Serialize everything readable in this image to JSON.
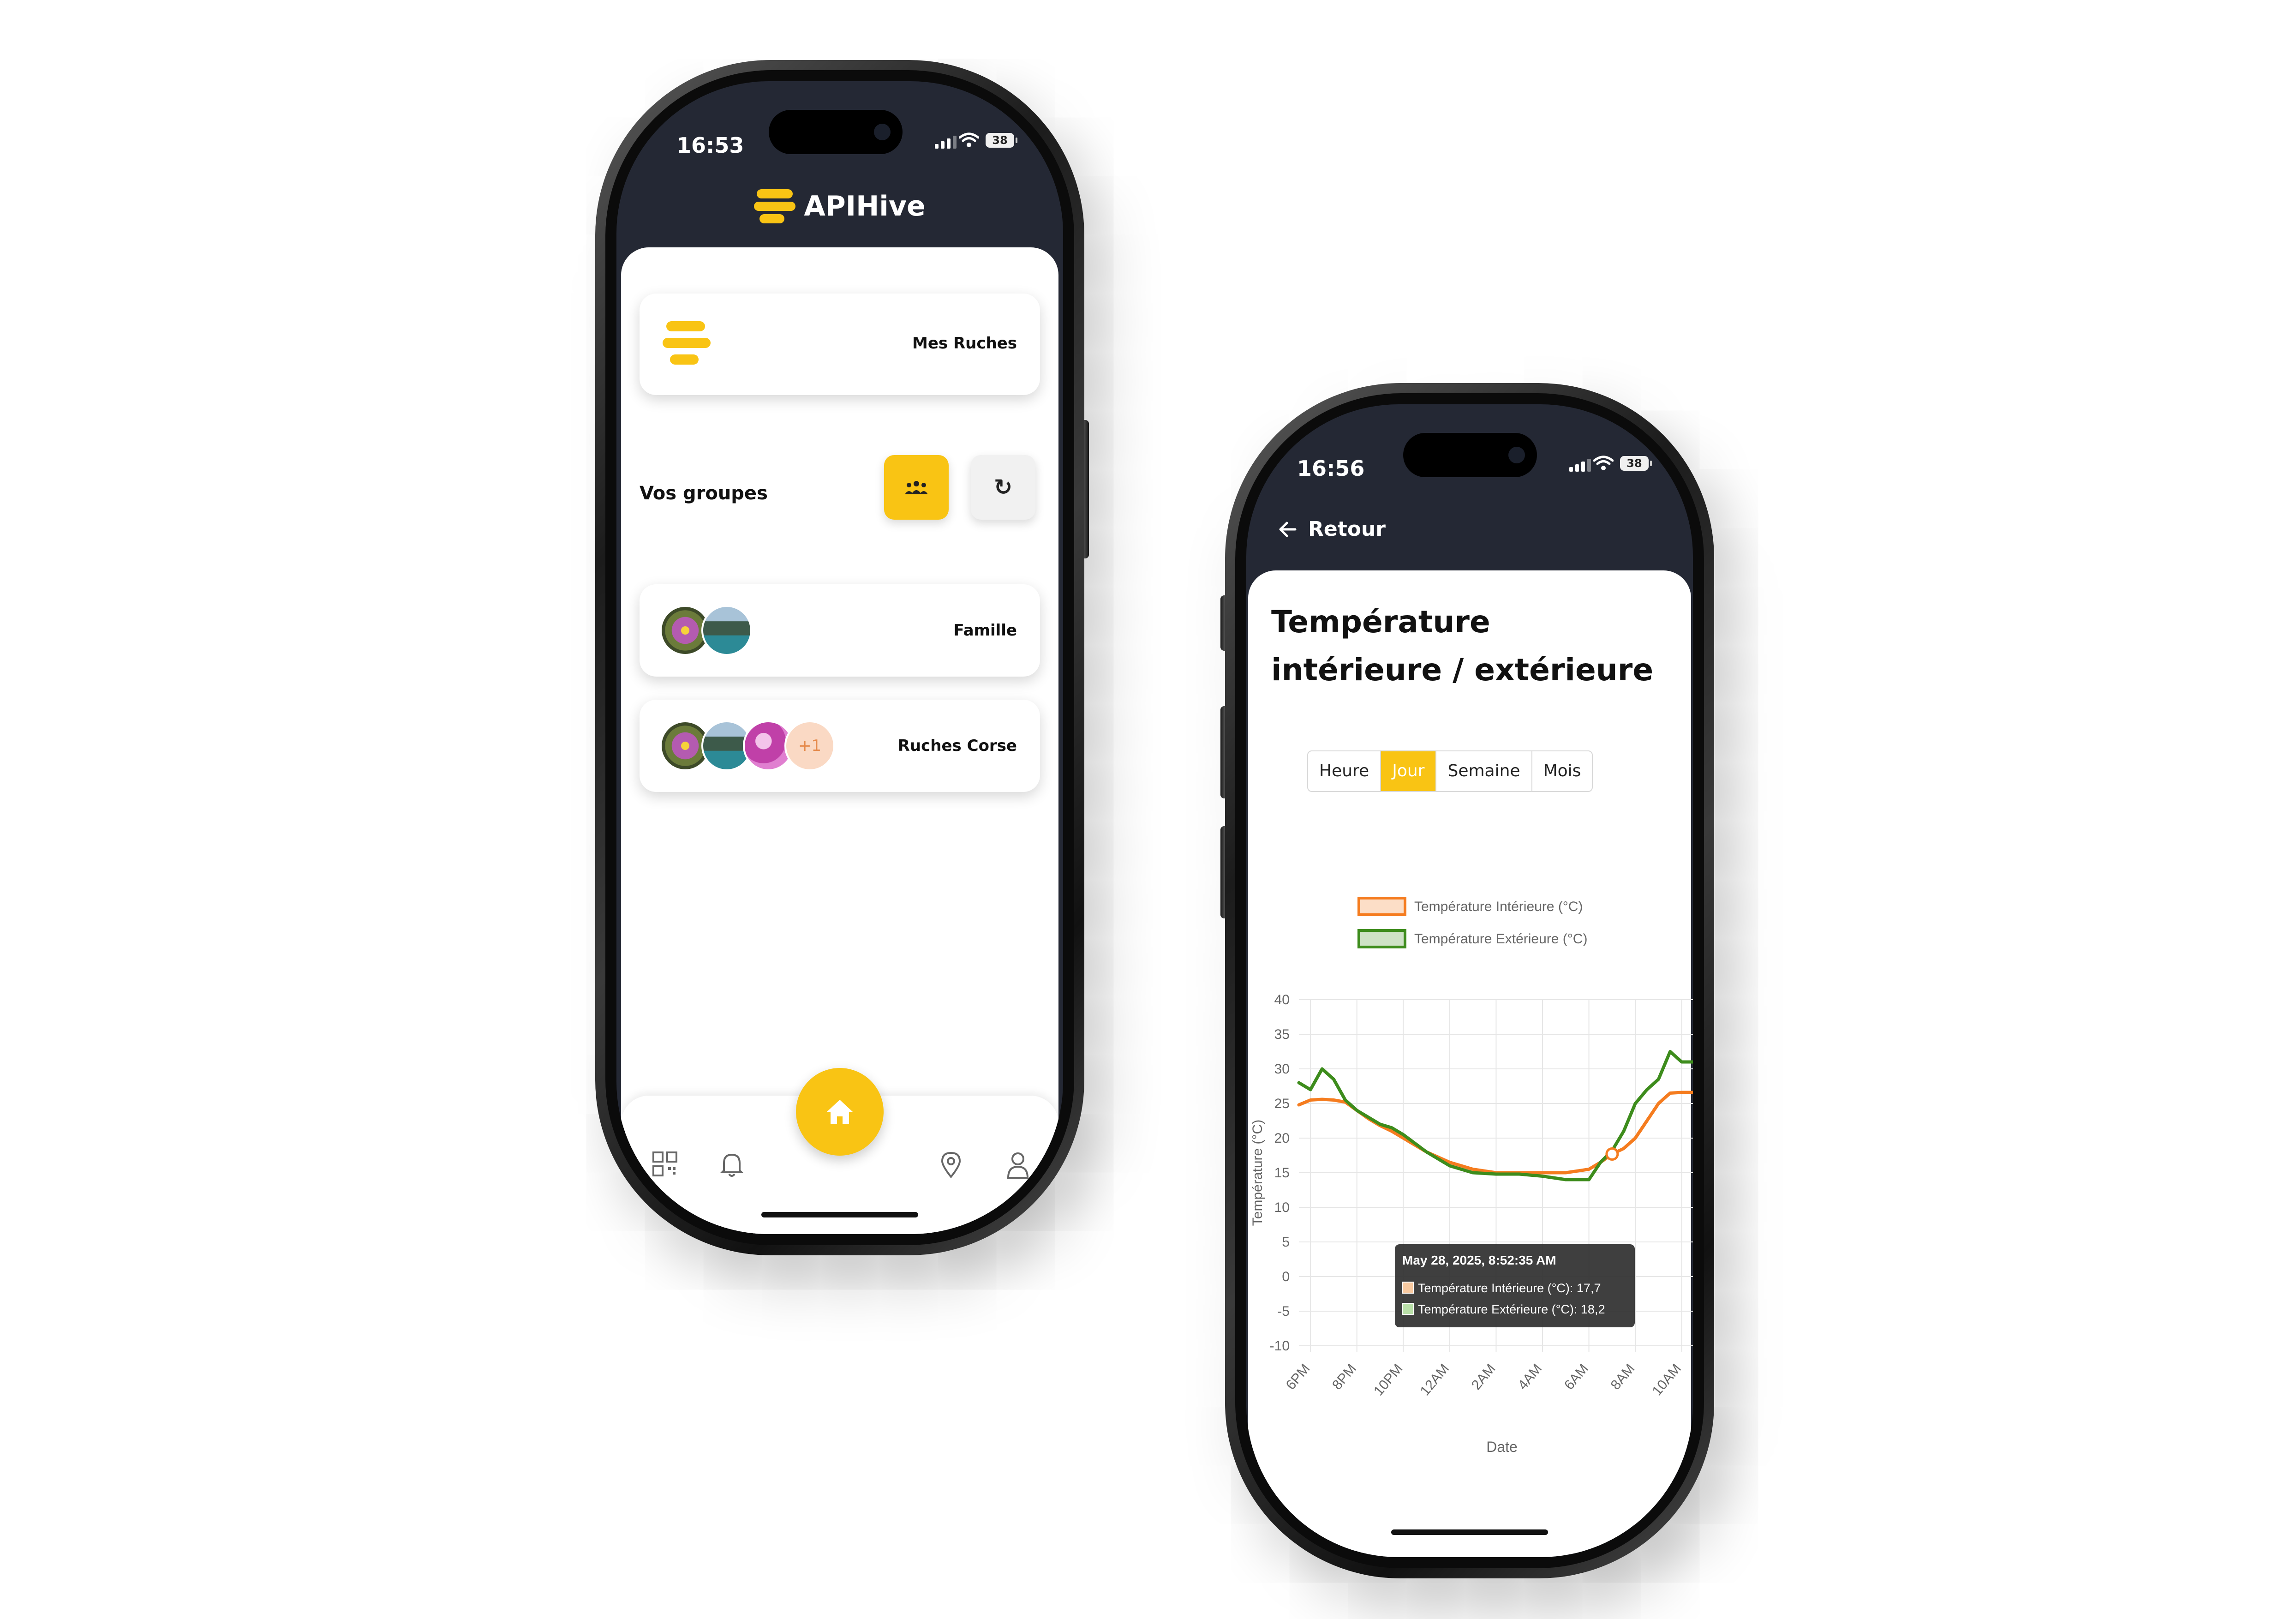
{
  "phone1": {
    "status": {
      "time": "16:53",
      "battery": "38"
    },
    "app_name": "APIHive",
    "hives_card": {
      "label": "Mes Ruches",
      "icon": "hive-logo-icon"
    },
    "groups": {
      "title": "Vos groupes",
      "groups_button_icon": "group-people-icon",
      "refresh_button_icon": "refresh-icon",
      "refresh_glyph": "↻",
      "items": [
        {
          "name": "Famille",
          "avatars": [
            "flower",
            "lake"
          ],
          "extra": ""
        },
        {
          "name": "Ruches Corse",
          "avatars": [
            "flower",
            "lake",
            "pink"
          ],
          "extra": "+1"
        }
      ]
    },
    "nav": {
      "items": [
        "qr-code-icon",
        "bell-icon",
        "home-icon",
        "map-pin-icon",
        "user-icon"
      ]
    }
  },
  "phone2": {
    "status": {
      "time": "16:56",
      "battery": "38"
    },
    "back_label": "Retour",
    "title": "Température intérieure / extérieure",
    "tabs": [
      "Heure",
      "Jour",
      "Semaine",
      "Mois"
    ],
    "active_tab": "Jour",
    "colors": {
      "accent": "#f9c414",
      "interior": "#f57c1f",
      "exterior": "#3d8c1c",
      "dark": "#242834"
    },
    "tooltip": {
      "title": "May 28, 2025, 8:52:35 AM",
      "interior": "Température Intérieure (°C): 17,7",
      "exterior": "Température Extérieure (°C): 18,2"
    }
  },
  "chart_data": {
    "type": "line",
    "xlabel": "Date",
    "ylabel": "Température (°C)",
    "ylim": [
      -10,
      40
    ],
    "yticks": [
      40,
      35,
      30,
      25,
      20,
      15,
      10,
      5,
      0,
      -5,
      -10
    ],
    "x_tick_labels": [
      "6PM",
      "8PM",
      "10PM",
      "12AM",
      "2AM",
      "4AM",
      "6AM",
      "8AM",
      "10AM"
    ],
    "x_hours": [
      17.5,
      18,
      18.5,
      19,
      19.5,
      20,
      20.5,
      21,
      21.5,
      22,
      23,
      24,
      25,
      26,
      27,
      28,
      29,
      30,
      30.5,
      31,
      31.5,
      32,
      32.5,
      33,
      33.5,
      34,
      34.5,
      35
    ],
    "series": [
      {
        "name": "Température Intérieure (°C)",
        "color": "#f57c1f",
        "values": [
          24.8,
          25.5,
          25.6,
          25.5,
          25.2,
          24.0,
          22.8,
          21.8,
          21.0,
          20.0,
          18.0,
          16.5,
          15.5,
          15.0,
          15.0,
          15.0,
          15.0,
          15.5,
          16.5,
          17.7,
          18.5,
          20.0,
          22.5,
          25.0,
          26.5,
          26.6,
          26.6,
          26.6
        ]
      },
      {
        "name": "Température Extérieure (°C)",
        "color": "#3d8c1c",
        "values": [
          28.0,
          27.0,
          30.0,
          28.5,
          25.5,
          24.0,
          23.0,
          22.0,
          21.5,
          20.5,
          18.0,
          16.0,
          15.0,
          14.8,
          14.8,
          14.5,
          14.0,
          14.0,
          16.5,
          18.2,
          21.0,
          25.0,
          27.0,
          28.5,
          32.5,
          31.0,
          31.0,
          31.0
        ]
      }
    ],
    "legend_position": "top",
    "grid": true
  }
}
